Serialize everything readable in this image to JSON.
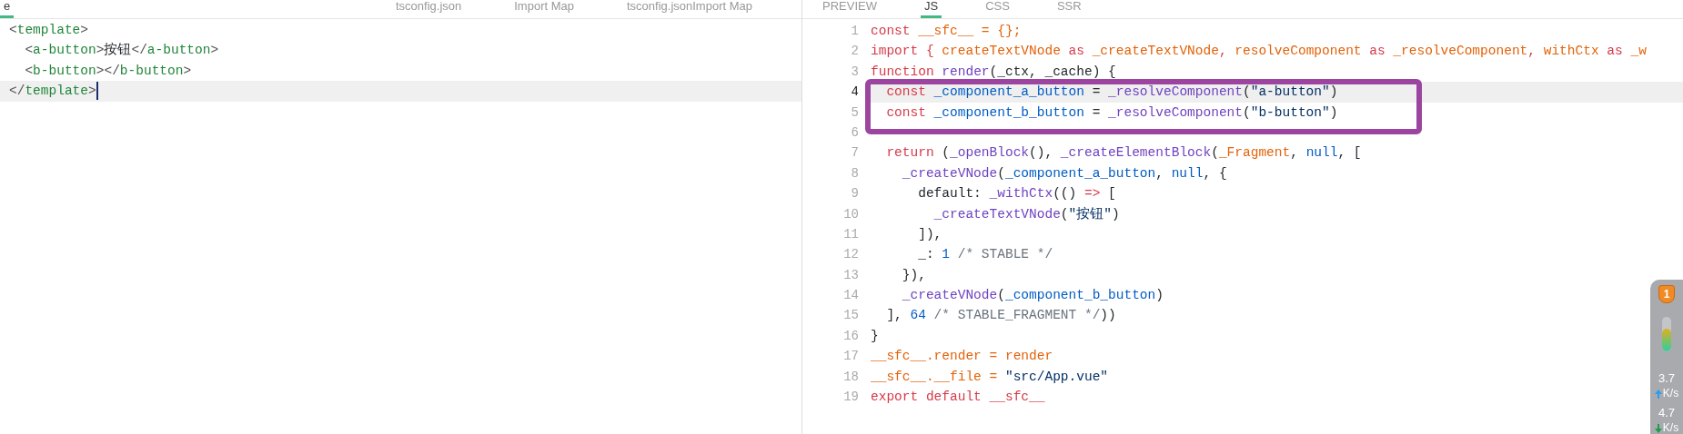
{
  "left_pane": {
    "tabs": [
      {
        "label": "e",
        "selected": true
      },
      {
        "label": "tsconfig.json",
        "selected": false
      },
      {
        "label": "Import Map",
        "selected": false
      },
      {
        "label": "tsconfig.jsonImport Map",
        "selected": false
      }
    ],
    "lines": [
      {
        "active": false,
        "tokens": [
          {
            "kind": "bracket",
            "text": "<"
          },
          {
            "kind": "tag",
            "text": "template"
          },
          {
            "kind": "bracket",
            "text": ">"
          }
        ]
      },
      {
        "active": false,
        "tokens": [
          {
            "kind": "bracket",
            "text": "  <"
          },
          {
            "kind": "tag",
            "text": "a-button"
          },
          {
            "kind": "bracket",
            "text": ">"
          },
          {
            "kind": "plain",
            "text": "按钮"
          },
          {
            "kind": "bracket",
            "text": "</"
          },
          {
            "kind": "tag",
            "text": "a-button"
          },
          {
            "kind": "bracket",
            "text": ">"
          }
        ]
      },
      {
        "active": false,
        "tokens": [
          {
            "kind": "bracket",
            "text": "  <"
          },
          {
            "kind": "tag",
            "text": "b-button"
          },
          {
            "kind": "bracket",
            "text": "></"
          },
          {
            "kind": "tag",
            "text": "b-button"
          },
          {
            "kind": "bracket",
            "text": ">"
          }
        ]
      },
      {
        "active": true,
        "tokens": [
          {
            "kind": "bracket",
            "text": "</"
          },
          {
            "kind": "tag",
            "text": "template"
          },
          {
            "kind": "bracket",
            "text": ">"
          }
        ]
      }
    ]
  },
  "right_pane": {
    "tabs": [
      {
        "label": "PREVIEW",
        "selected": false
      },
      {
        "label": "JS",
        "selected": true
      },
      {
        "label": "CSS",
        "selected": false
      },
      {
        "label": "SSR",
        "selected": false
      }
    ],
    "lines": [
      {
        "number": "1",
        "active": false,
        "boxed": false,
        "tokens": [
          {
            "kind": "kw",
            "text": "const"
          },
          {
            "kind": "var",
            "text": " __sfc__ = {};"
          }
        ]
      },
      {
        "number": "2",
        "active": false,
        "boxed": false,
        "tokens": [
          {
            "kind": "kw",
            "text": "import {"
          },
          {
            "kind": "var",
            "text": " createTextVNode"
          },
          {
            "kind": "kw",
            "text": " as "
          },
          {
            "kind": "var",
            "text": "_createTextVNode"
          },
          {
            "kind": "kw",
            "text": ", "
          },
          {
            "kind": "var",
            "text": "resolveComponent"
          },
          {
            "kind": "kw",
            "text": " as "
          },
          {
            "kind": "var",
            "text": "_resolveComponent"
          },
          {
            "kind": "kw",
            "text": ", "
          },
          {
            "kind": "var",
            "text": "withCtx"
          },
          {
            "kind": "kw",
            "text": " as "
          },
          {
            "kind": "var",
            "text": "_w"
          }
        ]
      },
      {
        "number": "3",
        "active": false,
        "boxed": false,
        "tokens": [
          {
            "kind": "kw",
            "text": "function"
          },
          {
            "kind": "fn",
            "text": " render"
          },
          {
            "kind": "plain",
            "text": "(_ctx, _cache) {"
          }
        ]
      },
      {
        "number": "4",
        "active": true,
        "boxed": true,
        "tokens": [
          {
            "kind": "kw",
            "text": "  const"
          },
          {
            "kind": "id",
            "text": " _component_a_button"
          },
          {
            "kind": "plain",
            "text": " = "
          },
          {
            "kind": "fn",
            "text": "_resolveComponent"
          },
          {
            "kind": "plain",
            "text": "("
          },
          {
            "kind": "str",
            "text": "\"a-button\""
          },
          {
            "kind": "plain",
            "text": ")"
          }
        ]
      },
      {
        "number": "5",
        "active": false,
        "boxed": true,
        "tokens": [
          {
            "kind": "kw",
            "text": "  const"
          },
          {
            "kind": "id",
            "text": " _component_b_button"
          },
          {
            "kind": "plain",
            "text": " = "
          },
          {
            "kind": "fn",
            "text": "_resolveComponent"
          },
          {
            "kind": "plain",
            "text": "("
          },
          {
            "kind": "str",
            "text": "\"b-button\""
          },
          {
            "kind": "plain",
            "text": ")"
          }
        ]
      },
      {
        "number": "6",
        "active": false,
        "boxed": false
      },
      {
        "number": "7",
        "active": false,
        "boxed": false,
        "tokens": [
          {
            "kind": "kw",
            "text": "  return"
          },
          {
            "kind": "plain",
            "text": " ("
          },
          {
            "kind": "fn",
            "text": "_openBlock"
          },
          {
            "kind": "plain",
            "text": "(), "
          },
          {
            "kind": "fn",
            "text": "_createElementBlock"
          },
          {
            "kind": "plain",
            "text": "("
          },
          {
            "kind": "var",
            "text": "_Fragment"
          },
          {
            "kind": "plain",
            "text": ", "
          },
          {
            "kind": "num",
            "text": "null"
          },
          {
            "kind": "plain",
            "text": ", ["
          }
        ]
      },
      {
        "number": "8",
        "active": false,
        "boxed": false,
        "tokens": [
          {
            "kind": "fn",
            "text": "    _createVNode"
          },
          {
            "kind": "plain",
            "text": "("
          },
          {
            "kind": "id",
            "text": "_component_a_button"
          },
          {
            "kind": "plain",
            "text": ", "
          },
          {
            "kind": "num",
            "text": "null"
          },
          {
            "kind": "plain",
            "text": ", {"
          }
        ]
      },
      {
        "number": "9",
        "active": false,
        "boxed": false,
        "tokens": [
          {
            "kind": "plain",
            "text": "      default: "
          },
          {
            "kind": "fn",
            "text": "_withCtx"
          },
          {
            "kind": "plain",
            "text": "(() "
          },
          {
            "kind": "kw",
            "text": "=>"
          },
          {
            "kind": "plain",
            "text": " ["
          }
        ]
      },
      {
        "number": "10",
        "active": false,
        "boxed": false,
        "tokens": [
          {
            "kind": "fn",
            "text": "        _createTextVNode"
          },
          {
            "kind": "plain",
            "text": "("
          },
          {
            "kind": "str",
            "text": "\"按钮\""
          },
          {
            "kind": "plain",
            "text": ")"
          }
        ]
      },
      {
        "number": "11",
        "active": false,
        "boxed": false,
        "tokens": [
          {
            "kind": "plain",
            "text": "      ]),"
          }
        ]
      },
      {
        "number": "12",
        "active": false,
        "boxed": false,
        "tokens": [
          {
            "kind": "plain",
            "text": "      _: "
          },
          {
            "kind": "num",
            "text": "1"
          },
          {
            "kind": "comment",
            "text": " /* STABLE */"
          }
        ]
      },
      {
        "number": "13",
        "active": false,
        "boxed": false,
        "tokens": [
          {
            "kind": "plain",
            "text": "    }),"
          }
        ]
      },
      {
        "number": "14",
        "active": false,
        "boxed": false,
        "tokens": [
          {
            "kind": "fn",
            "text": "    _createVNode"
          },
          {
            "kind": "plain",
            "text": "("
          },
          {
            "kind": "id",
            "text": "_component_b_button"
          },
          {
            "kind": "plain",
            "text": ")"
          }
        ]
      },
      {
        "number": "15",
        "active": false,
        "boxed": false,
        "tokens": [
          {
            "kind": "plain",
            "text": "  ], "
          },
          {
            "kind": "num",
            "text": "64"
          },
          {
            "kind": "comment",
            "text": " /* STABLE_FRAGMENT */"
          },
          {
            "kind": "plain",
            "text": "))"
          }
        ]
      },
      {
        "number": "16",
        "active": false,
        "boxed": false,
        "tokens": [
          {
            "kind": "plain",
            "text": "}"
          }
        ]
      },
      {
        "number": "17",
        "active": false,
        "boxed": false,
        "tokens": [
          {
            "kind": "var",
            "text": "__sfc__.render = render"
          }
        ]
      },
      {
        "number": "18",
        "active": false,
        "boxed": false,
        "tokens": [
          {
            "kind": "var",
            "text": "__sfc__.__file = "
          },
          {
            "kind": "str",
            "text": "\"src/App.vue\""
          }
        ]
      },
      {
        "number": "19",
        "active": false,
        "boxed": false,
        "tokens": [
          {
            "kind": "kw",
            "text": "export default __sfc__"
          }
        ]
      }
    ]
  },
  "network_widget": {
    "badge": "1",
    "level": 0.65,
    "upload": {
      "value": "3.7",
      "unit": "K/s"
    },
    "download": {
      "value": "4.7",
      "unit": "K/s"
    }
  }
}
